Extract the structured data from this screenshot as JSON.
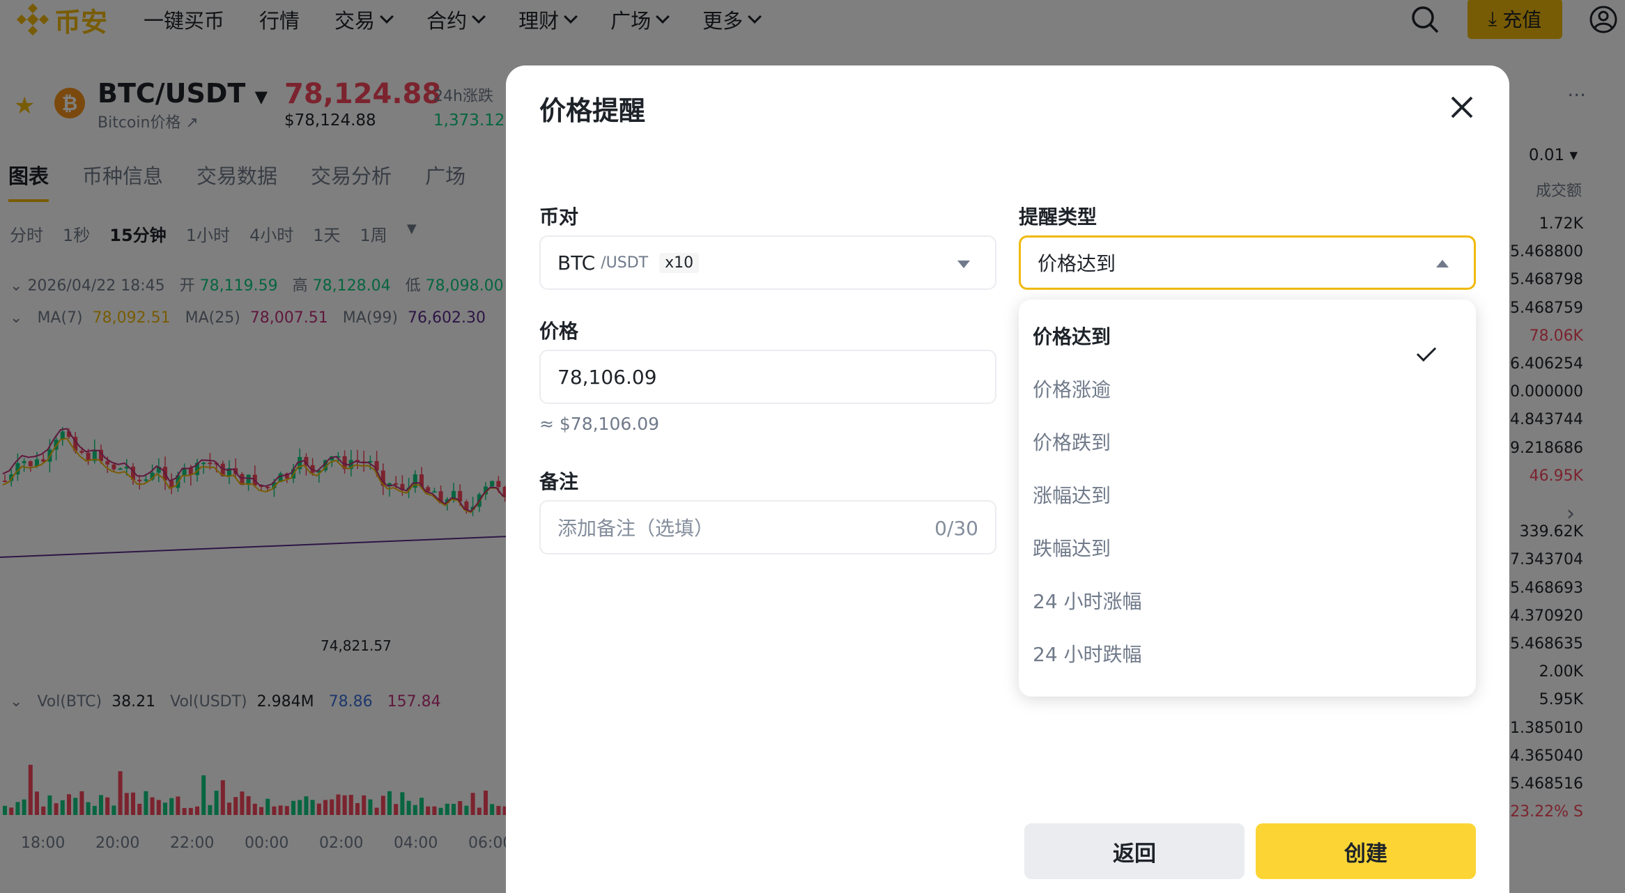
{
  "nav": {
    "logo_text": "币安",
    "links": [
      "一键买币",
      "行情",
      "交易",
      "合约",
      "理财",
      "广场",
      "更多"
    ],
    "deposit_label": "充值"
  },
  "pair": {
    "name": "BTC/USDT",
    "subtitle": "Bitcoin价格 ↗",
    "price": "78,124.88",
    "usd_price": "$78,124.88",
    "change_label": "24h涨跌",
    "change_value": "1,373.12"
  },
  "tabs": [
    "图表",
    "币种信息",
    "交易数据",
    "交易分析",
    "广场"
  ],
  "intervals": [
    "分时",
    "1秒",
    "15分钟",
    "1小时",
    "4小时",
    "1天",
    "1周"
  ],
  "ohlc": {
    "date": "2026/04/22 18:45",
    "open_label": "开",
    "open": "78,119.59",
    "high_label": "高",
    "high": "78,128.04",
    "low_label": "低",
    "low": "78,098.00"
  },
  "ma": {
    "ma7_label": "MA(7)",
    "ma7": "78,092.51",
    "ma25_label": "MA(25)",
    "ma25": "78,007.51",
    "ma99_label": "MA(99)",
    "ma99": "76,602.30"
  },
  "low_marker": "74,821.57",
  "volume": {
    "btc_label": "Vol(BTC)",
    "btc": "38.21",
    "usdt_label": "Vol(USDT)",
    "usdt": "2.984M",
    "v1": "78.86",
    "v2": "157.84"
  },
  "time_axis": [
    "18:00",
    "20:00",
    "22:00",
    "00:00",
    "02:00",
    "04:00",
    "06:00"
  ],
  "orderbook": {
    "tick": "0.01",
    "header": "成交额",
    "values": [
      "1.72K",
      "5.468800",
      "5.468798",
      "5.468759",
      "78.06K",
      "6.406254",
      "0.000000",
      "4.843744",
      "9.218686",
      "46.95K",
      "",
      "339.62K",
      "7.343704",
      "5.468693",
      "4.370920",
      "5.468635",
      "2.00K",
      "5.95K",
      "1.385010",
      "4.365040",
      "5.468516",
      "23.22% S"
    ]
  },
  "modal": {
    "title": "价格提醒",
    "pair_label": "币对",
    "pair_base": "BTC",
    "pair_quote": "/USDT",
    "pair_leverage": "x10",
    "alert_type_label": "提醒类型",
    "alert_type_value": "价格达到",
    "price_label": "价格",
    "price_value": "78,106.09",
    "price_hint": "≈ $78,106.09",
    "note_label": "备注",
    "note_placeholder": "添加备注（选填）",
    "note_counter": "0/30",
    "back_label": "返回",
    "create_label": "创建"
  },
  "alert_options": [
    "价格达到",
    "价格涨逾",
    "价格跌到",
    "涨幅达到",
    "跌幅达到",
    "24 小时涨幅",
    "24 小时跌幅"
  ],
  "colors": {
    "accent": "#F0B90B",
    "up": "#0ECB81",
    "down": "#F6465D"
  }
}
